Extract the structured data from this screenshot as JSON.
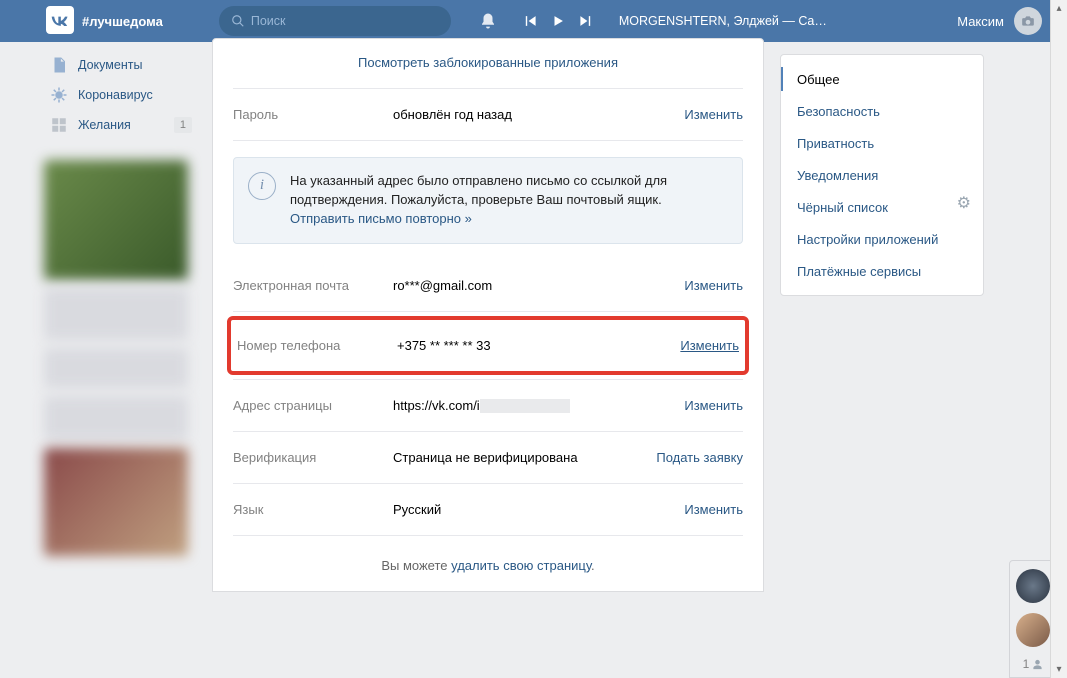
{
  "header": {
    "hashtag": "#лучшедома",
    "search_placeholder": "Поиск",
    "track": "MORGENSHTERN, Элджей — Cadill...",
    "username": "Максим"
  },
  "leftnav": {
    "items": [
      {
        "label": "Документы",
        "icon": "document-icon"
      },
      {
        "label": "Коронавирус",
        "icon": "virus-icon"
      },
      {
        "label": "Желания",
        "icon": "squares-icon",
        "badge": "1"
      }
    ]
  },
  "main": {
    "blocked_apps_link": "Посмотреть заблокированные приложения",
    "rows": {
      "password": {
        "label": "Пароль",
        "value": "обновлён год назад",
        "action": "Изменить"
      },
      "email": {
        "label": "Электронная почта",
        "value": "ro***@gmail.com",
        "action": "Изменить"
      },
      "phone": {
        "label": "Номер телефона",
        "value": "+375 ** *** ** 33",
        "action": "Изменить"
      },
      "address": {
        "label": "Адрес страницы",
        "value": "https://vk.com/i",
        "action": "Изменить"
      },
      "verify": {
        "label": "Верификация",
        "value": "Страница не верифицирована",
        "action": "Подать заявку"
      },
      "lang": {
        "label": "Язык",
        "value": "Русский",
        "action": "Изменить"
      }
    },
    "infobox": {
      "text": "На указанный адрес было отправлено письмо со ссылкой для подтверждения. Пожалуйста, проверьте Ваш почтовый ящик.",
      "resend": "Отправить письмо повторно »"
    },
    "delete": {
      "prefix": "Вы можете ",
      "link": "удалить свою страницу",
      "suffix": "."
    }
  },
  "rightnav": {
    "items": [
      "Общее",
      "Безопасность",
      "Приватность",
      "Уведомления",
      "Чёрный список",
      "Настройки приложений",
      "Платёжные сервисы"
    ]
  },
  "friendbar": {
    "count": "1"
  }
}
